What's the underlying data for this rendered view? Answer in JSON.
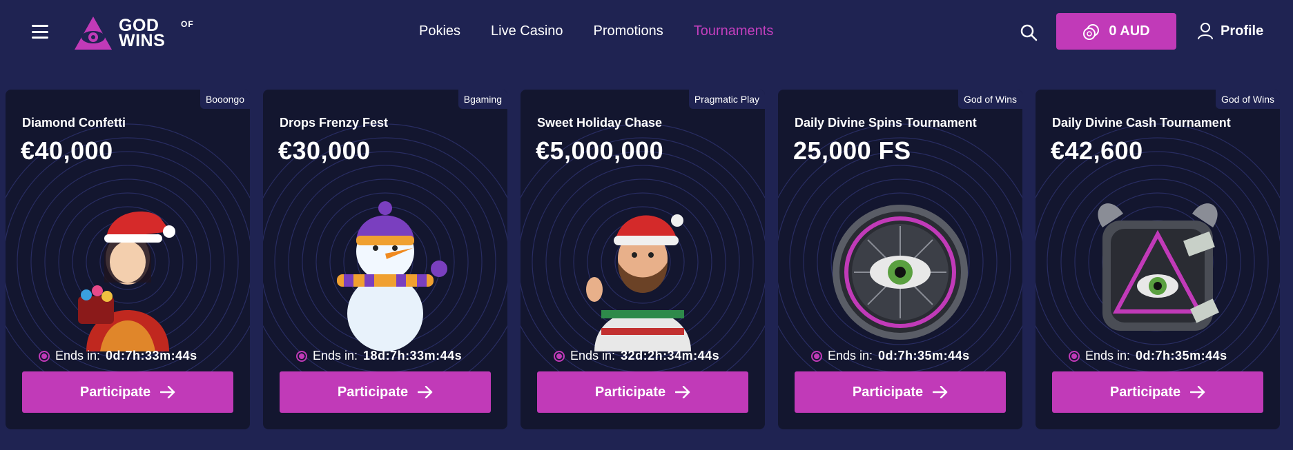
{
  "brand": {
    "name_top": "GOD",
    "name_bottom": "WINS",
    "name_of": "OF",
    "accent_color": "#c13ab8",
    "background_color": "#1f2352"
  },
  "header": {
    "menu_icon": "hamburger-icon",
    "nav": [
      {
        "label": "Pokies",
        "active": false
      },
      {
        "label": "Live Casino",
        "active": false
      },
      {
        "label": "Promotions",
        "active": false
      },
      {
        "label": "Tournaments",
        "active": true
      }
    ],
    "search_icon": "search-icon",
    "balance_label": "0 AUD",
    "balance_icon": "coins-icon",
    "profile_label": "Profile",
    "profile_icon": "user-icon"
  },
  "tournaments": [
    {
      "provider": "Booongo",
      "title": "Diamond Confetti",
      "prize": "€40,000",
      "ends_label": "Ends in:",
      "ends_time": "0d:7h:33m:44s",
      "button": "Participate",
      "art": "santa-girl-illustration"
    },
    {
      "provider": "Bgaming",
      "title": "Drops Frenzy Fest",
      "prize": "€30,000",
      "ends_label": "Ends in:",
      "ends_time": "18d:7h:33m:44s",
      "button": "Participate",
      "art": "snowman-illustration"
    },
    {
      "provider": "Pragmatic Play",
      "title": "Sweet Holiday Chase",
      "prize": "€5,000,000",
      "ends_label": "Ends in:",
      "ends_time": "32d:2h:34m:44s",
      "button": "Participate",
      "art": "bearded-santa-illustration"
    },
    {
      "provider": "God of Wins",
      "title": "Daily Divine Spins Tournament",
      "prize": "25,000 FS",
      "ends_label": "Ends in:",
      "ends_time": "0d:7h:35m:44s",
      "button": "Participate",
      "art": "eye-medallion-illustration"
    },
    {
      "provider": "God of Wins",
      "title": "Daily Divine Cash Tournament",
      "prize": "€42,600",
      "ends_label": "Ends in:",
      "ends_time": "0d:7h:35m:44s",
      "button": "Participate",
      "art": "eye-triangle-illustration"
    }
  ]
}
